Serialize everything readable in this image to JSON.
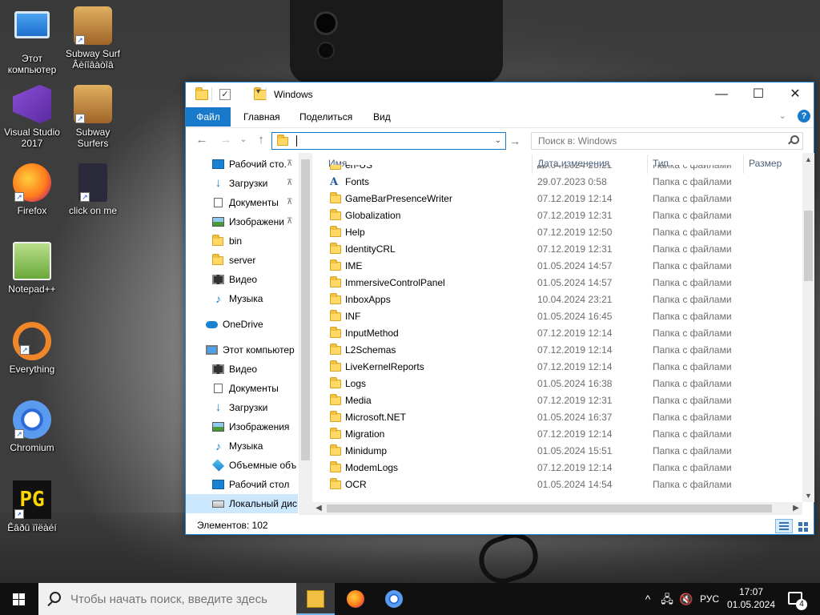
{
  "desktop": {
    "icons": [
      {
        "label": "Этот\nкомпьютер"
      },
      {
        "label": "Subway Surf Âèíîâàòîâ"
      },
      {
        "label": "Visual Studio 2017"
      },
      {
        "label": "Subway Surfers"
      },
      {
        "label": "Firefox"
      },
      {
        "label": "click on me"
      },
      {
        "label": "Notepad++"
      },
      {
        "label": "Everything"
      },
      {
        "label": "Chromium"
      },
      {
        "label": "Êâðû ïîëàéí"
      }
    ]
  },
  "window": {
    "title": "Windows",
    "controls": {
      "minimize": "—",
      "maximize": "☐",
      "close": "✕"
    },
    "ribbon": {
      "tabs": [
        "Файл",
        "Главная",
        "Поделиться",
        "Вид"
      ],
      "expand_icon": "chevron-down-icon",
      "help_label": "?"
    },
    "nav": {
      "back": "←",
      "forward": "→",
      "recent": "⌄",
      "up": "↑",
      "address_value": "",
      "address_dropdown": "⌄",
      "go": "→",
      "search_placeholder": "Поиск в: Windows"
    },
    "navpane": [
      {
        "label": "Рабочий сто.",
        "icon": "desktop-icon",
        "pinned": true
      },
      {
        "label": "Загрузки",
        "icon": "downloads-icon",
        "pinned": true
      },
      {
        "label": "Документы",
        "icon": "documents-icon",
        "pinned": true
      },
      {
        "label": "Изображени",
        "icon": "pictures-icon",
        "pinned": true
      },
      {
        "label": "bin",
        "icon": "folder-icon",
        "pinned": false
      },
      {
        "label": "server",
        "icon": "folder-icon",
        "pinned": false
      },
      {
        "label": "Видео",
        "icon": "videos-icon",
        "pinned": false
      },
      {
        "label": "Музыка",
        "icon": "music-icon",
        "pinned": false
      },
      {
        "label": "OneDrive",
        "icon": "onedrive-icon",
        "pinned": false
      },
      {
        "label": "Этот компьютер",
        "icon": "this-pc-icon",
        "pinned": false
      },
      {
        "label": "Видео",
        "icon": "videos-icon",
        "pinned": false
      },
      {
        "label": "Документы",
        "icon": "documents-icon",
        "pinned": false
      },
      {
        "label": "Загрузки",
        "icon": "downloads-icon",
        "pinned": false
      },
      {
        "label": "Изображения",
        "icon": "pictures-icon",
        "pinned": false
      },
      {
        "label": "Музыка",
        "icon": "music-icon",
        "pinned": false
      },
      {
        "label": "Объемные объ",
        "icon": "3d-objects-icon",
        "pinned": false
      },
      {
        "label": "Рабочий стол",
        "icon": "desktop-icon",
        "pinned": false
      },
      {
        "label": "Локальный дис",
        "icon": "local-disk-icon",
        "pinned": false,
        "selected": true
      }
    ],
    "pin_glyph": "📌",
    "columns": [
      "Имя",
      "Дата изменения",
      "Тип",
      "Размер"
    ],
    "rows": [
      {
        "name": "en-US",
        "date": "10.04.2024 23:21",
        "type": "Папка с файлами"
      },
      {
        "name": "Fonts",
        "date": "29.07.2023 0:58",
        "type": "Папка с файлами",
        "icon": "font-folder-icon"
      },
      {
        "name": "GameBarPresenceWriter",
        "date": "07.12.2019 12:14",
        "type": "Папка с файлами"
      },
      {
        "name": "Globalization",
        "date": "07.12.2019 12:31",
        "type": "Папка с файлами"
      },
      {
        "name": "Help",
        "date": "07.12.2019 12:50",
        "type": "Папка с файлами"
      },
      {
        "name": "IdentityCRL",
        "date": "07.12.2019 12:31",
        "type": "Папка с файлами"
      },
      {
        "name": "IME",
        "date": "01.05.2024 14:57",
        "type": "Папка с файлами"
      },
      {
        "name": "ImmersiveControlPanel",
        "date": "01.05.2024 14:57",
        "type": "Папка с файлами"
      },
      {
        "name": "InboxApps",
        "date": "10.04.2024 23:21",
        "type": "Папка с файлами"
      },
      {
        "name": "INF",
        "date": "01.05.2024 16:45",
        "type": "Папка с файлами"
      },
      {
        "name": "InputMethod",
        "date": "07.12.2019 12:14",
        "type": "Папка с файлами"
      },
      {
        "name": "L2Schemas",
        "date": "07.12.2019 12:14",
        "type": "Папка с файлами"
      },
      {
        "name": "LiveKernelReports",
        "date": "07.12.2019 12:14",
        "type": "Папка с файлами"
      },
      {
        "name": "Logs",
        "date": "01.05.2024 16:38",
        "type": "Папка с файлами"
      },
      {
        "name": "Media",
        "date": "07.12.2019 12:31",
        "type": "Папка с файлами"
      },
      {
        "name": "Microsoft.NET",
        "date": "01.05.2024 16:37",
        "type": "Папка с файлами"
      },
      {
        "name": "Migration",
        "date": "07.12.2019 12:14",
        "type": "Папка с файлами"
      },
      {
        "name": "Minidump",
        "date": "01.05.2024 15:51",
        "type": "Папка с файлами"
      },
      {
        "name": "ModemLogs",
        "date": "07.12.2019 12:14",
        "type": "Папка с файлами"
      },
      {
        "name": "OCR",
        "date": "01.05.2024 14:54",
        "type": "Папка с файлами"
      }
    ],
    "status": {
      "items_count": "Элементов: 102"
    }
  },
  "taskbar": {
    "search_placeholder": "Чтобы начать поиск, введите здесь",
    "apps": [
      "file-explorer-icon",
      "firefox-icon",
      "chromium-icon"
    ],
    "tray": {
      "chevron": "^",
      "language": "РУС",
      "time": "17:07",
      "date": "01.05.2024",
      "notifications_count": "4"
    }
  }
}
